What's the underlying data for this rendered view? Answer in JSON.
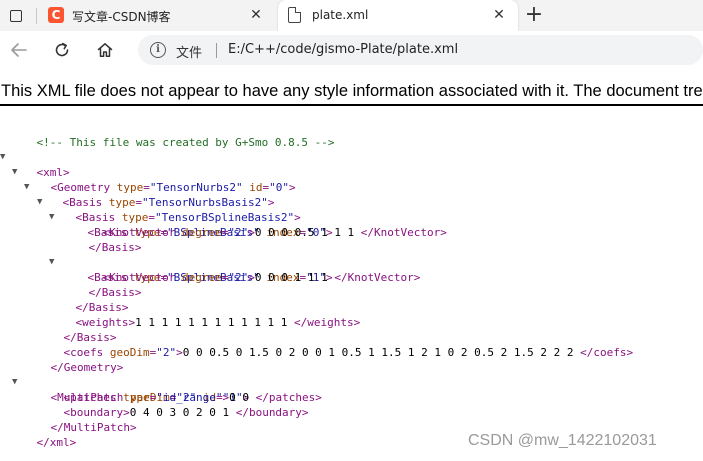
{
  "browser": {
    "tabs": [
      {
        "title": "写文章-CSDN博客",
        "favicon": "csdn-icon",
        "favicon_letter": "C",
        "close": "✕"
      },
      {
        "title": "plate.xml",
        "favicon": "document-icon",
        "close": "✕"
      }
    ],
    "new_tab": "+",
    "address_label": "文件",
    "url": "E:/C++/code/gismo-Plate/plate.xml"
  },
  "viewer": {
    "notice": "This XML file does not appear to have any style information associated with it. The document tree is shown below."
  },
  "xml": {
    "comment": "<!-- This file was created by G+Smo 0.8.5 -->",
    "root_open": "<xml>",
    "geometry_open": {
      "tag": "Geometry",
      "attrs": [
        {
          "n": "type",
          "v": "TensorNurbs2"
        },
        {
          "n": "id",
          "v": "0"
        }
      ]
    },
    "basis_nurbs_open": {
      "tag": "Basis",
      "attrs": [
        {
          "n": "type",
          "v": "TensorNurbsBasis2"
        }
      ]
    },
    "basis_bspline_open": {
      "tag": "Basis",
      "attrs": [
        {
          "n": "type",
          "v": "TensorBSplineBasis2"
        }
      ]
    },
    "basis0_open": {
      "tag": "Basis",
      "attrs": [
        {
          "n": "type",
          "v": "BSplineBasis"
        },
        {
          "n": "index",
          "v": "0"
        }
      ]
    },
    "knot0": {
      "tag": "KnotVector",
      "attrs": [
        {
          "n": "degree",
          "v": "2"
        }
      ],
      "text": "0 0 0 0.5 1 1 1"
    },
    "basis_close": "</Basis>",
    "basis1_open": {
      "tag": "Basis",
      "attrs": [
        {
          "n": "type",
          "v": "BSplineBasis"
        },
        {
          "n": "index",
          "v": "1"
        }
      ]
    },
    "knot1": {
      "tag": "KnotVector",
      "attrs": [
        {
          "n": "degree",
          "v": "2"
        }
      ],
      "text": "0 0 0 1 1 1"
    },
    "weights": {
      "tag": "weights",
      "text": "1 1 1 1 1 1 1 1 1 1 1 1"
    },
    "coefs": {
      "tag": "coefs",
      "attrs": [
        {
          "n": "geoDim",
          "v": "2"
        }
      ],
      "text": "0 0 0.5 0 1.5 0 2 0 0 1 0.5 1 1.5 1 2 1 0 2 0.5 2 1.5 2 2 2"
    },
    "geometry_close": "</Geometry>",
    "multipatch_open": {
      "tag": "MultiPatch",
      "attrs": [
        {
          "n": "parDim",
          "v": "2"
        },
        {
          "n": "id",
          "v": "1"
        }
      ]
    },
    "patches": {
      "tag": "patches",
      "attrs": [
        {
          "n": "type",
          "v": "id_range"
        }
      ],
      "text": "0 0"
    },
    "boundary": {
      "tag": "boundary",
      "text": "0 4 0 3 0 2 0 1"
    },
    "multipatch_close": "</MultiPatch>",
    "root_close": "</xml>",
    "toggle_glyph": "▼"
  },
  "watermark": "CSDN @mw_1422102031",
  "colors": {
    "tag": "#881280",
    "attr": "#994500",
    "value": "#1a1aa6",
    "comment": "#236e25"
  }
}
